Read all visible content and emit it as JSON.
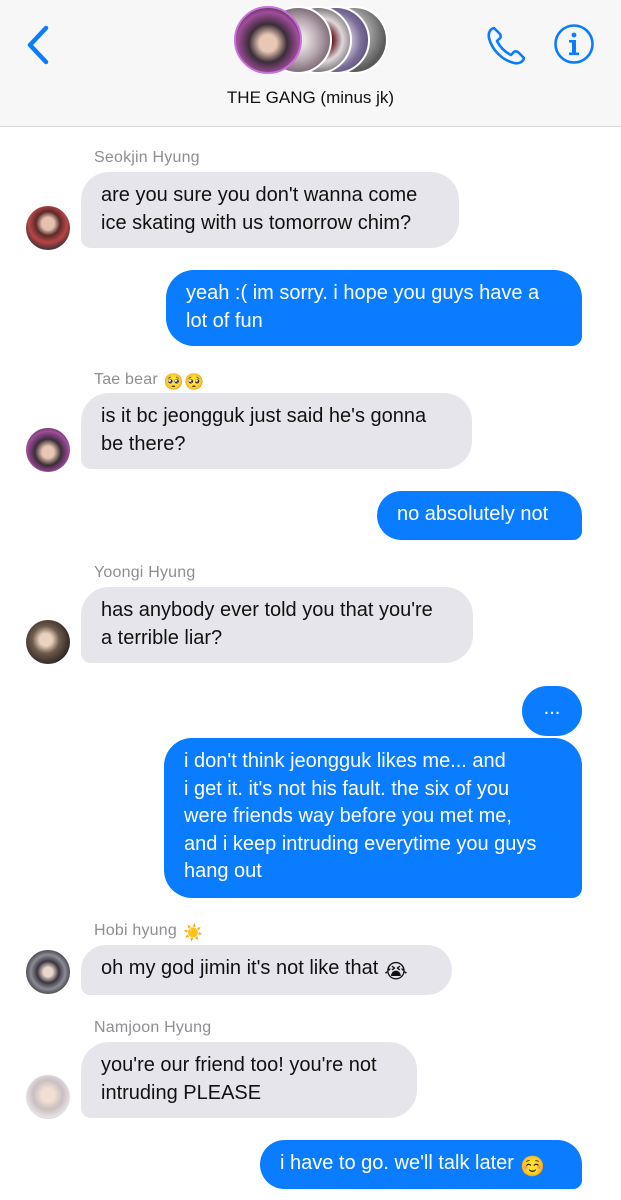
{
  "header": {
    "title": "THE GANG (minus jk)",
    "back_icon": "chevron-left-icon",
    "call_icon": "phone-icon",
    "info_icon": "info-icon",
    "accent": "#0a7cff"
  },
  "messages": [
    {
      "sender": "Seokjin Hyung",
      "direction": "in",
      "lines": [
        "are you sure you don't wanna come",
        "ice skating with us tomorrow chim?"
      ]
    },
    {
      "direction": "out",
      "lines": [
        "yeah :( im sorry. i hope you guys have a",
        "lot of fun"
      ]
    },
    {
      "sender": "Tae bear",
      "sender_emoji": "🥺🥺",
      "direction": "in",
      "lines": [
        "is it bc jeongguk just said he's gonna",
        "be there?"
      ]
    },
    {
      "direction": "out",
      "lines": [
        "no absolutely not"
      ]
    },
    {
      "sender": "Yoongi Hyung",
      "direction": "in",
      "lines": [
        "has anybody ever told you that you're",
        "a terrible liar?"
      ]
    },
    {
      "direction": "out",
      "lines": [
        "..."
      ]
    },
    {
      "direction": "out",
      "lines": [
        "i don't think jeongguk likes me... and",
        "i get it. it's not his fault. the six of you",
        "were friends way before you met me,",
        "and i keep intruding everytime you guys",
        "hang out"
      ]
    },
    {
      "sender": "Hobi hyung",
      "sender_emoji": "☀️",
      "direction": "in",
      "lines": [
        "oh my god jimin it's not like that"
      ],
      "emoji": "😭"
    },
    {
      "sender": "Namjoon Hyung",
      "direction": "in",
      "lines": [
        "you're our friend too! you're not",
        "intruding PLEASE"
      ]
    },
    {
      "direction": "out",
      "lines": [
        "i have to go. we'll talk later"
      ],
      "emoji": "☺️"
    }
  ],
  "colors": {
    "outgoing_bubble": "#0a7cff",
    "incoming_bubble": "#e6e5eb",
    "sender_name": "#8e8e93"
  }
}
